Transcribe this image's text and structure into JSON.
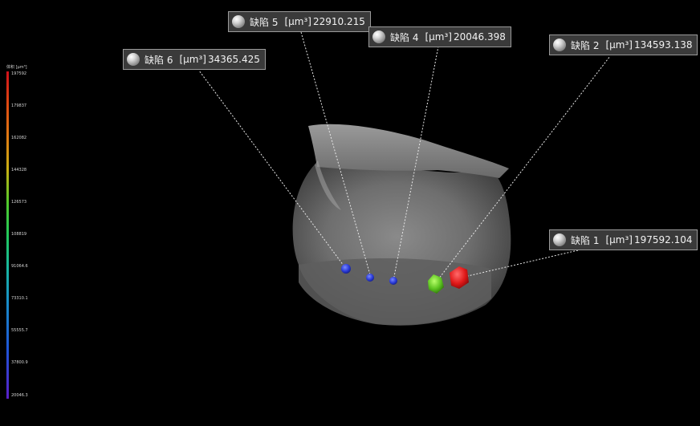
{
  "legend": {
    "title": "体积 [µm³]",
    "ticks": [
      "197592",
      "179837",
      "162082",
      "144328",
      "126573",
      "108819",
      "91064.6",
      "73310.1",
      "55555.7",
      "37800.9",
      "20046.3"
    ]
  },
  "defects": [
    {
      "name": "缺陷 1",
      "unit": "[µm³]",
      "value": "197592.104",
      "color": "#e02020"
    },
    {
      "name": "缺陷 2",
      "unit": "[µm³]",
      "value": "134593.138",
      "color": "#6ad02a"
    },
    {
      "name": "缺陷 4",
      "unit": "[µm³]",
      "value": "20046.398",
      "color": "#2a3ad8"
    },
    {
      "name": "缺陷 5",
      "unit": "[µm³]",
      "value": "22910.215",
      "color": "#2a3ad8"
    },
    {
      "name": "缺陷 6",
      "unit": "[µm³]",
      "value": "34365.425",
      "color": "#2a4ae0"
    }
  ]
}
